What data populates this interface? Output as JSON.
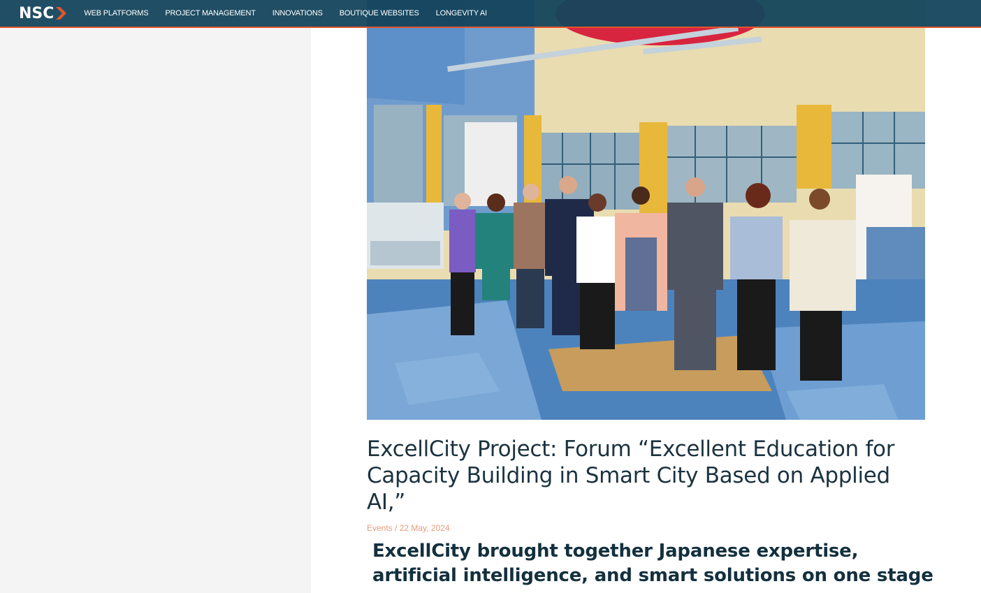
{
  "nav": {
    "logo_text": "NSC",
    "items": [
      {
        "label": "WEB PLATFORMS"
      },
      {
        "label": "PROJECT MANAGEMENT"
      },
      {
        "label": "INNOVATIONS"
      },
      {
        "label": "BOUTIQUE WEBSITES"
      },
      {
        "label": "LONGEVITY AI"
      }
    ],
    "bar_color": "#14445c",
    "accent_color": "#e0552e"
  },
  "article": {
    "title": "ExcellCity Project: Forum “Excellent Education for Capacity Building in Smart City Based on Applied AI,”",
    "category": "Events",
    "separator": " / ",
    "date": "22 May, 2024",
    "subtitle": "ExcellCity brought together Japanese expertise, artificial intelligence, and smart solutions on one stage"
  }
}
